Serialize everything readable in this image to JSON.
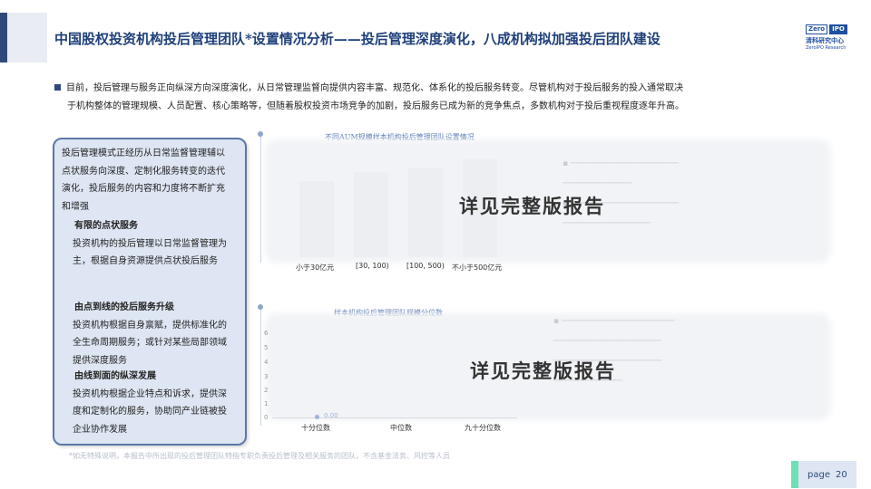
{
  "header": {
    "title": "中国股权投资机构投后管理团队*设置情况分析——投后管理深度演化，八成机构拟加强投后团队建设",
    "logo": {
      "box1": "Zero",
      "box2": "IPO",
      "cn": "清科研究中心",
      "en": "ZeroIPO Research"
    }
  },
  "intro": {
    "line1": "目前，投后管理与服务正向纵深方向深度演化，从日常管理监督向提供内容丰富、规范化、体系化的投后服务转变。尽管机构对于投后服务的投入通常取决",
    "line2": "于机构整体的管理规模、人员配置、核心策略等，但随着股权投资市场竞争的加剧，投后服务已成为新的竞争焦点，多数机构对于投后重视程度逐年升高。"
  },
  "left_box": {
    "summary": "投后管理模式正经历从日常监督管理辅以点状服务向深度、定制化服务转变的迭代演化，投后服务的内容和力度将不断扩充和增强",
    "sections": [
      {
        "heading": "有限的点状服务",
        "body": "投资机构的投后管理以日常监督管理为主，根据自身资源提供点状投后服务"
      },
      {
        "heading": "由点到线的投后服务升级",
        "body": "投资机构根据自身禀赋，提供标准化的全生命周期服务；或针对某些局部领域提供深度服务"
      },
      {
        "heading": "由线到面的纵深发展",
        "body": "投资机构根据企业特点和诉求，提供深度和定制化的服务，协助同产业链被投企业协作发展"
      }
    ]
  },
  "chart1": {
    "title": "不同AUM规模样本机构投后管理团队设置情况",
    "categories": [
      "小于30亿元",
      "[30, 100)",
      "[100, 500)",
      "不小于500亿元"
    ],
    "overlay": "详见完整版报告"
  },
  "chart2": {
    "title": "样本机构投后管理团队规模分位数",
    "categories": [
      "十分位数",
      "中位数",
      "九十分位数"
    ],
    "y_ticks": [
      "6",
      "5",
      "4",
      "3",
      "2",
      "1",
      "0"
    ],
    "value_label": "0.00",
    "overlay": "详见完整版报告"
  },
  "footnote": "*如无特殊说明，本报告中所出现的投后管理团队特指专职负责投后管理及相关服务的团队，不含基金法务、风控等人员",
  "page": {
    "label": "page",
    "number": "20"
  }
}
